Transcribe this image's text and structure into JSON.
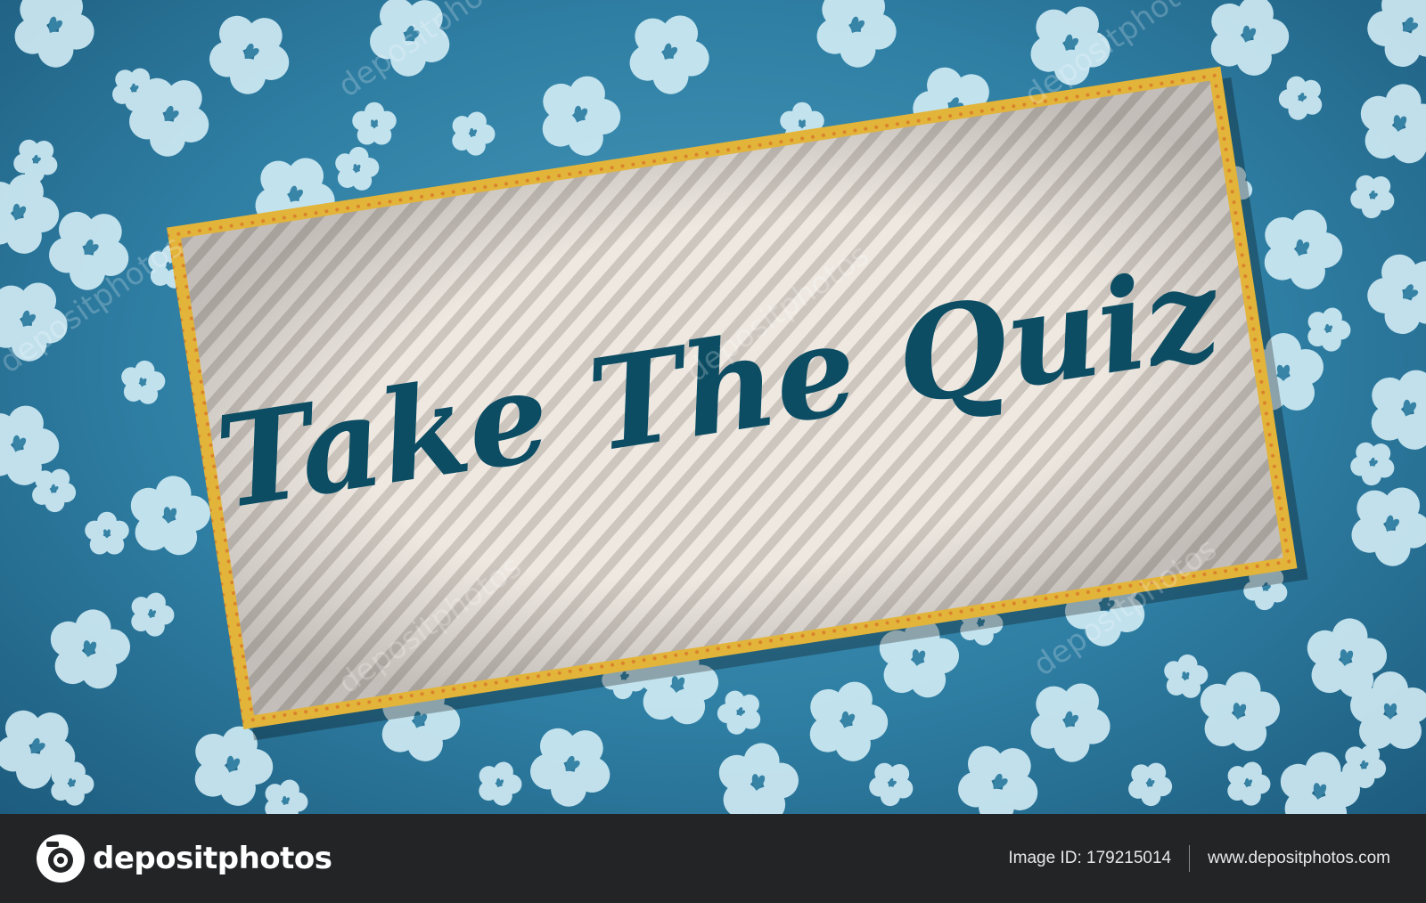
{
  "sign": {
    "title": "Take The Quiz"
  },
  "watermark": {
    "text": "depositphotos"
  },
  "footer": {
    "brand": "depositphotos",
    "image_id": "Image ID: 179215014",
    "site_url": "www.depositphotos.com"
  },
  "colors": {
    "background": "#2f7fa4",
    "flower": "#d6f0f7",
    "frame": "#e2b43a",
    "panel": "#ece6df",
    "text": "#0c4d63",
    "footer": "#222426"
  }
}
